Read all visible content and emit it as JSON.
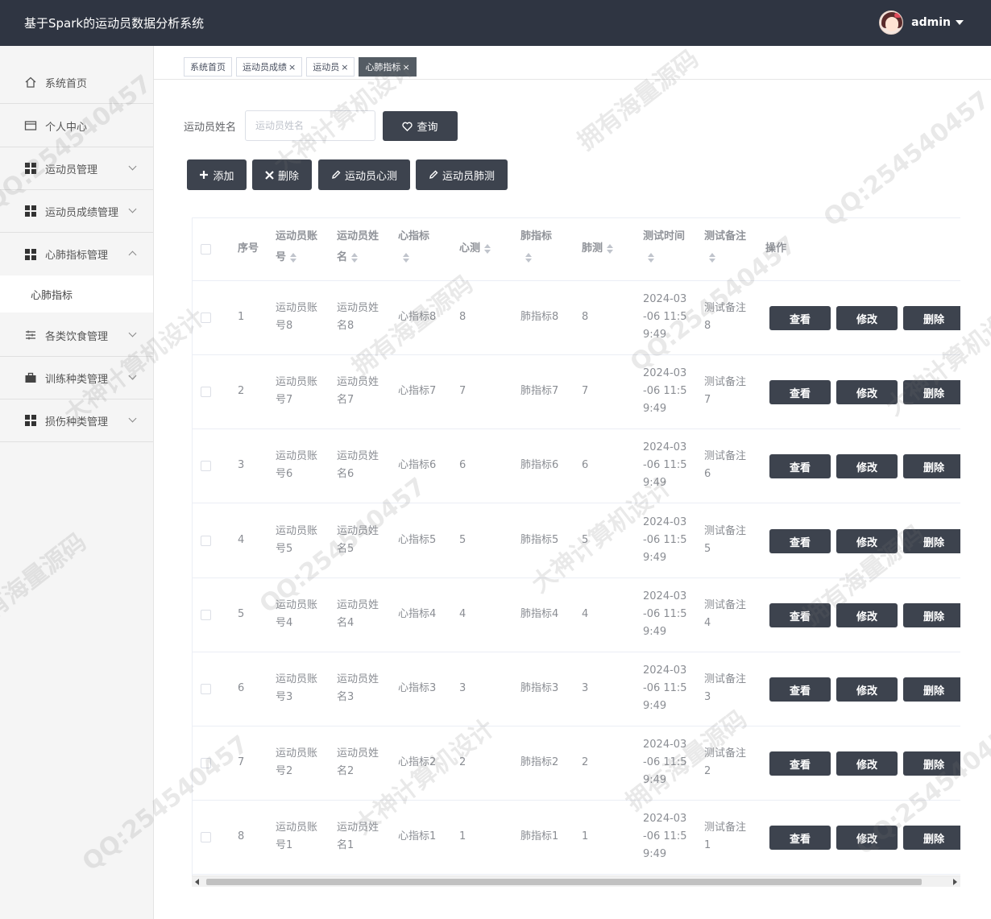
{
  "header": {
    "title": "基于Spark的运动员数据分析系统",
    "username": "admin"
  },
  "sidebar": {
    "items": [
      {
        "label": "系统首页",
        "icon": "home-icon",
        "expandable": false
      },
      {
        "label": "个人中心",
        "icon": "id-card-icon",
        "expandable": false
      },
      {
        "label": "运动员管理",
        "icon": "grid-icon",
        "expandable": true
      },
      {
        "label": "运动员成绩管理",
        "icon": "grid-icon",
        "expandable": true
      },
      {
        "label": "心肺指标管理",
        "icon": "grid-icon",
        "expandable": true,
        "expanded": true
      },
      {
        "label": "各类饮食管理",
        "icon": "sliders-icon",
        "expandable": true
      },
      {
        "label": "训练种类管理",
        "icon": "briefcase-icon",
        "expandable": true
      },
      {
        "label": "损伤种类管理",
        "icon": "grid-icon",
        "expandable": true
      }
    ],
    "submenu": {
      "label": "心肺指标"
    }
  },
  "tabs": [
    {
      "label": "系统首页",
      "closable": false,
      "active": false
    },
    {
      "label": "运动员成绩",
      "closable": true,
      "active": false
    },
    {
      "label": "运动员",
      "closable": true,
      "active": false
    },
    {
      "label": "心肺指标",
      "closable": true,
      "active": true
    }
  ],
  "search": {
    "label": "运动员姓名",
    "placeholder": "运动员姓名",
    "value": "",
    "button": "查询"
  },
  "toolbar": {
    "add": "添加",
    "delete": "删除",
    "heart_test": "运动员心测",
    "lung_test": "运动员肺测"
  },
  "table": {
    "columns": {
      "index": "序号",
      "account": [
        "运动员账",
        "号"
      ],
      "name": [
        "运动员姓",
        "名"
      ],
      "heart_index": "心指标",
      "heart_test": "心测",
      "lung_index": "肺指标",
      "lung_test": "肺测",
      "test_time": "测试时间",
      "test_note": "测试备注",
      "actions": "操作"
    },
    "actions": {
      "view": "查看",
      "edit": "修改",
      "delete": "删除"
    },
    "rows": [
      {
        "index": "1",
        "account": [
          "运动员账",
          "号8"
        ],
        "name": [
          "运动员姓",
          "名8"
        ],
        "heart_index": "心指标8",
        "heart_test": "8",
        "lung_index": "肺指标8",
        "lung_test": "8",
        "time": [
          "2024-03",
          "-06 11:5",
          "9:49"
        ],
        "note": [
          "测试备注",
          "8"
        ]
      },
      {
        "index": "2",
        "account": [
          "运动员账",
          "号7"
        ],
        "name": [
          "运动员姓",
          "名7"
        ],
        "heart_index": "心指标7",
        "heart_test": "7",
        "lung_index": "肺指标7",
        "lung_test": "7",
        "time": [
          "2024-03",
          "-06 11:5",
          "9:49"
        ],
        "note": [
          "测试备注",
          "7"
        ]
      },
      {
        "index": "3",
        "account": [
          "运动员账",
          "号6"
        ],
        "name": [
          "运动员姓",
          "名6"
        ],
        "heart_index": "心指标6",
        "heart_test": "6",
        "lung_index": "肺指标6",
        "lung_test": "6",
        "time": [
          "2024-03",
          "-06 11:5",
          "9:49"
        ],
        "note": [
          "测试备注",
          "6"
        ]
      },
      {
        "index": "4",
        "account": [
          "运动员账",
          "号5"
        ],
        "name": [
          "运动员姓",
          "名5"
        ],
        "heart_index": "心指标5",
        "heart_test": "5",
        "lung_index": "肺指标5",
        "lung_test": "5",
        "time": [
          "2024-03",
          "-06 11:5",
          "9:49"
        ],
        "note": [
          "测试备注",
          "5"
        ]
      },
      {
        "index": "5",
        "account": [
          "运动员账",
          "号4"
        ],
        "name": [
          "运动员姓",
          "名4"
        ],
        "heart_index": "心指标4",
        "heart_test": "4",
        "lung_index": "肺指标4",
        "lung_test": "4",
        "time": [
          "2024-03",
          "-06 11:5",
          "9:49"
        ],
        "note": [
          "测试备注",
          "4"
        ]
      },
      {
        "index": "6",
        "account": [
          "运动员账",
          "号3"
        ],
        "name": [
          "运动员姓",
          "名3"
        ],
        "heart_index": "心指标3",
        "heart_test": "3",
        "lung_index": "肺指标3",
        "lung_test": "3",
        "time": [
          "2024-03",
          "-06 11:5",
          "9:49"
        ],
        "note": [
          "测试备注",
          "3"
        ]
      },
      {
        "index": "7",
        "account": [
          "运动员账",
          "号2"
        ],
        "name": [
          "运动员姓",
          "名2"
        ],
        "heart_index": "心指标2",
        "heart_test": "2",
        "lung_index": "肺指标2",
        "lung_test": "2",
        "time": [
          "2024-03",
          "-06 11:5",
          "9:49"
        ],
        "note": [
          "测试备注",
          "2"
        ]
      },
      {
        "index": "8",
        "account": [
          "运动员账",
          "号1"
        ],
        "name": [
          "运动员姓",
          "名1"
        ],
        "heart_index": "心指标1",
        "heart_test": "1",
        "lung_index": "肺指标1",
        "lung_test": "1",
        "time": [
          "2024-03",
          "-06 11:5",
          "9:49"
        ],
        "note": [
          "测试备注",
          "1"
        ]
      }
    ]
  },
  "watermarks": [
    "QQ:254540457",
    "大神计算机设计",
    "拥有海量源码"
  ],
  "colors": {
    "header_bg": "#2f3542",
    "button_dark": "#3d434e",
    "active_tab": "#545c64"
  }
}
